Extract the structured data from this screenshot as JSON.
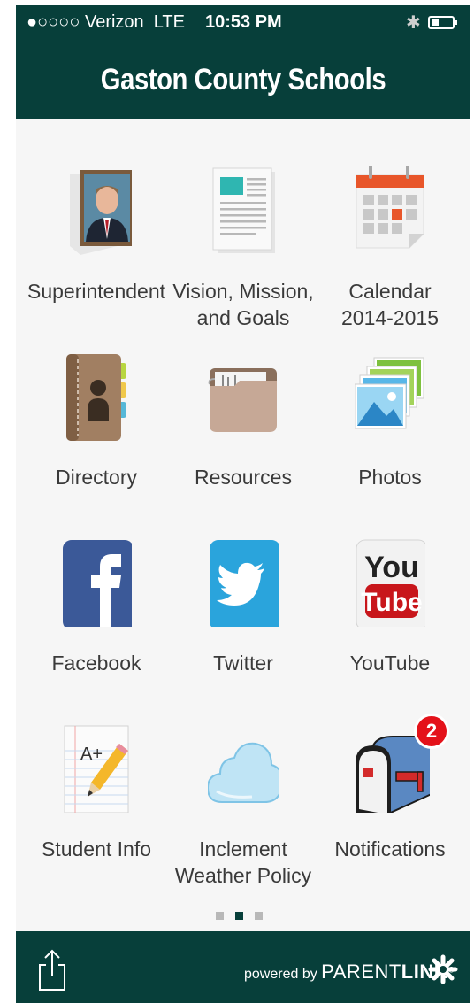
{
  "status_bar": {
    "carrier": "●○○○○ Verizon",
    "network": "LTE",
    "time": "10:53 PM"
  },
  "header": {
    "title": "Gaston County Schools"
  },
  "grid": [
    {
      "label_line1": "Superintendent",
      "label_line2": "",
      "icon": "superintendent-photo-icon"
    },
    {
      "label_line1": "Vision, Mission,",
      "label_line2": "and Goals",
      "icon": "newspaper-icon"
    },
    {
      "label_line1": "Calendar",
      "label_line2": "2014-2015",
      "icon": "calendar-icon"
    },
    {
      "label_line1": "Directory",
      "label_line2": "",
      "icon": "address-book-icon"
    },
    {
      "label_line1": "Resources",
      "label_line2": "",
      "icon": "folder-icon"
    },
    {
      "label_line1": "Photos",
      "label_line2": "",
      "icon": "photos-icon"
    },
    {
      "label_line1": "Facebook",
      "label_line2": "",
      "icon": "facebook-icon"
    },
    {
      "label_line1": "Twitter",
      "label_line2": "",
      "icon": "twitter-icon"
    },
    {
      "label_line1": "YouTube",
      "label_line2": "",
      "icon": "youtube-icon"
    },
    {
      "label_line1": "Student Info",
      "label_line2": "",
      "icon": "graded-paper-icon"
    },
    {
      "label_line1": "Inclement",
      "label_line2": "Weather Policy",
      "icon": "cloud-icon"
    },
    {
      "label_line1": "Notifications",
      "label_line2": "",
      "icon": "mailbox-icon",
      "badge": "2"
    }
  ],
  "pagination": {
    "pages": 3,
    "current": 2
  },
  "footer": {
    "powered_by": "powered by",
    "brand_light": "PARENT",
    "brand_bold": "LINK",
    "registered": "®"
  },
  "colors": {
    "primary": "#073f3a",
    "badge": "#e4121a",
    "label": "#3a3a3a",
    "background": "#f6f6f6"
  }
}
